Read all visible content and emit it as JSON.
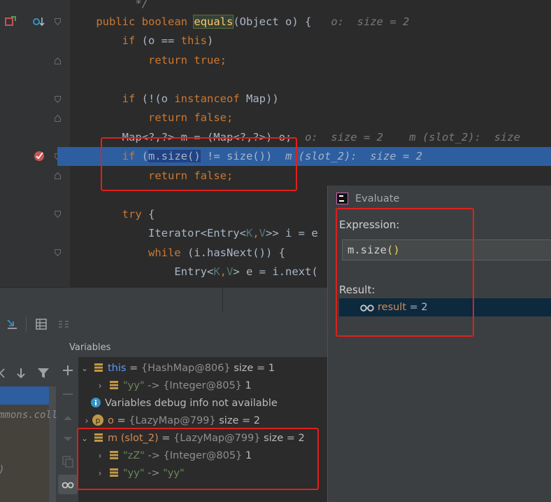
{
  "editor": {
    "lines": [
      {
        "html_key": "l0"
      },
      {
        "html_key": "l1"
      }
    ],
    "comment_end": "*/",
    "sig_kw1": "public",
    "sig_kw2": "boolean",
    "sig_fn": "equals",
    "sig_rest": "(Object o) {",
    "sig_hint": "o:  size = 2",
    "l_if1": "if (o == ",
    "l_if1_this": "this",
    "l_if1_end": ")",
    "l_ret_true_kw": "return",
    "l_ret_true_val": "true;",
    "l_if2_kw": "if",
    "l_if2_a": " (!(o ",
    "l_if2_inst": "instanceof",
    "l_if2_b": " Map))",
    "l_ret_false_kw": "return",
    "l_ret_false_val": "false;",
    "l_map_text": "Map<?,?> m = (Map<?,?>) o;",
    "l_map_hint1": "o:  size = 2",
    "l_map_hint2": "m (slot_2):  size",
    "l_cur_kw": "if",
    "l_cur_a": " (",
    "l_cur_sel": "m.size()",
    "l_cur_b": " != size())",
    "l_cur_hint": "m (slot_2):  size = 2",
    "l_ret_false2_kw": "return",
    "l_ret_false2_val": "false;",
    "l_try_kw": "try",
    "l_try_rest": " {",
    "l_iter_a": "Iterator<Entry<",
    "l_iter_k": "K",
    "l_iter_comma": ",",
    "l_iter_v": "V",
    "l_iter_b": ">> i = e",
    "l_while_kw": "while",
    "l_while_rest": " (i.hasNext()) {",
    "l_entry_a": "Entry<",
    "l_entry_k": "K",
    "l_entry_comma": ",",
    "l_entry_v": "V",
    "l_entry_b": "> e = i.next("
  },
  "debug": {
    "variables_header": "Variables",
    "rows": [
      {
        "name": "this",
        "eq": " = ",
        "ref": "{HashMap@806}",
        "extra": "  size = 1"
      },
      {
        "name": "\"yy\"",
        "arrow": " -> ",
        "ref": "{Integer@805}",
        "extra": " 1"
      },
      {
        "info": "Variables debug info not available"
      },
      {
        "name": "o",
        "eq": " = ",
        "ref": "{LazyMap@799}",
        "extra": "  size = 2"
      },
      {
        "name": "m (slot_2)",
        "eq": " = ",
        "ref": "{LazyMap@799}",
        "extra": "  size = 2"
      },
      {
        "name": "\"zZ\"",
        "arrow": " -> ",
        "ref": "{Integer@805}",
        "extra": " 1"
      },
      {
        "name": "\"yy\"",
        "arrow": " -> ",
        "val": "\"yy\""
      }
    ],
    "frame_partial": "mmons.colle",
    "frame_partial2": ")"
  },
  "evaluate": {
    "title": "Evaluate",
    "expression_label": "Expression:",
    "expression_a": "m.size",
    "expression_paren": "()",
    "result_label": "Result:",
    "result_name": "result",
    "result_eq": " = ",
    "result_value": "2"
  },
  "colors": {
    "highlight_box": "#e0201c",
    "current_line": "#2d5ea0",
    "keyword": "#cc7832"
  }
}
